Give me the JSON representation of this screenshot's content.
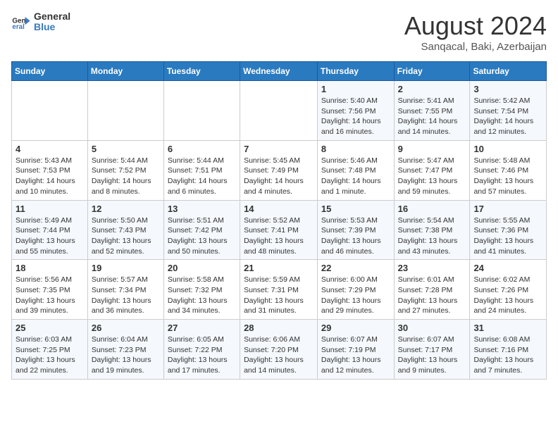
{
  "header": {
    "logo_general": "General",
    "logo_blue": "Blue",
    "month_year": "August 2024",
    "location": "Sanqacal, Baki, Azerbaijan"
  },
  "weekdays": [
    "Sunday",
    "Monday",
    "Tuesday",
    "Wednesday",
    "Thursday",
    "Friday",
    "Saturday"
  ],
  "weeks": [
    [
      {
        "day": "",
        "content": ""
      },
      {
        "day": "",
        "content": ""
      },
      {
        "day": "",
        "content": ""
      },
      {
        "day": "",
        "content": ""
      },
      {
        "day": "1",
        "content": "Sunrise: 5:40 AM\nSunset: 7:56 PM\nDaylight: 14 hours\nand 16 minutes."
      },
      {
        "day": "2",
        "content": "Sunrise: 5:41 AM\nSunset: 7:55 PM\nDaylight: 14 hours\nand 14 minutes."
      },
      {
        "day": "3",
        "content": "Sunrise: 5:42 AM\nSunset: 7:54 PM\nDaylight: 14 hours\nand 12 minutes."
      }
    ],
    [
      {
        "day": "4",
        "content": "Sunrise: 5:43 AM\nSunset: 7:53 PM\nDaylight: 14 hours\nand 10 minutes."
      },
      {
        "day": "5",
        "content": "Sunrise: 5:44 AM\nSunset: 7:52 PM\nDaylight: 14 hours\nand 8 minutes."
      },
      {
        "day": "6",
        "content": "Sunrise: 5:44 AM\nSunset: 7:51 PM\nDaylight: 14 hours\nand 6 minutes."
      },
      {
        "day": "7",
        "content": "Sunrise: 5:45 AM\nSunset: 7:49 PM\nDaylight: 14 hours\nand 4 minutes."
      },
      {
        "day": "8",
        "content": "Sunrise: 5:46 AM\nSunset: 7:48 PM\nDaylight: 14 hours\nand 1 minute."
      },
      {
        "day": "9",
        "content": "Sunrise: 5:47 AM\nSunset: 7:47 PM\nDaylight: 13 hours\nand 59 minutes."
      },
      {
        "day": "10",
        "content": "Sunrise: 5:48 AM\nSunset: 7:46 PM\nDaylight: 13 hours\nand 57 minutes."
      }
    ],
    [
      {
        "day": "11",
        "content": "Sunrise: 5:49 AM\nSunset: 7:44 PM\nDaylight: 13 hours\nand 55 minutes."
      },
      {
        "day": "12",
        "content": "Sunrise: 5:50 AM\nSunset: 7:43 PM\nDaylight: 13 hours\nand 52 minutes."
      },
      {
        "day": "13",
        "content": "Sunrise: 5:51 AM\nSunset: 7:42 PM\nDaylight: 13 hours\nand 50 minutes."
      },
      {
        "day": "14",
        "content": "Sunrise: 5:52 AM\nSunset: 7:41 PM\nDaylight: 13 hours\nand 48 minutes."
      },
      {
        "day": "15",
        "content": "Sunrise: 5:53 AM\nSunset: 7:39 PM\nDaylight: 13 hours\nand 46 minutes."
      },
      {
        "day": "16",
        "content": "Sunrise: 5:54 AM\nSunset: 7:38 PM\nDaylight: 13 hours\nand 43 minutes."
      },
      {
        "day": "17",
        "content": "Sunrise: 5:55 AM\nSunset: 7:36 PM\nDaylight: 13 hours\nand 41 minutes."
      }
    ],
    [
      {
        "day": "18",
        "content": "Sunrise: 5:56 AM\nSunset: 7:35 PM\nDaylight: 13 hours\nand 39 minutes."
      },
      {
        "day": "19",
        "content": "Sunrise: 5:57 AM\nSunset: 7:34 PM\nDaylight: 13 hours\nand 36 minutes."
      },
      {
        "day": "20",
        "content": "Sunrise: 5:58 AM\nSunset: 7:32 PM\nDaylight: 13 hours\nand 34 minutes."
      },
      {
        "day": "21",
        "content": "Sunrise: 5:59 AM\nSunset: 7:31 PM\nDaylight: 13 hours\nand 31 minutes."
      },
      {
        "day": "22",
        "content": "Sunrise: 6:00 AM\nSunset: 7:29 PM\nDaylight: 13 hours\nand 29 minutes."
      },
      {
        "day": "23",
        "content": "Sunrise: 6:01 AM\nSunset: 7:28 PM\nDaylight: 13 hours\nand 27 minutes."
      },
      {
        "day": "24",
        "content": "Sunrise: 6:02 AM\nSunset: 7:26 PM\nDaylight: 13 hours\nand 24 minutes."
      }
    ],
    [
      {
        "day": "25",
        "content": "Sunrise: 6:03 AM\nSunset: 7:25 PM\nDaylight: 13 hours\nand 22 minutes."
      },
      {
        "day": "26",
        "content": "Sunrise: 6:04 AM\nSunset: 7:23 PM\nDaylight: 13 hours\nand 19 minutes."
      },
      {
        "day": "27",
        "content": "Sunrise: 6:05 AM\nSunset: 7:22 PM\nDaylight: 13 hours\nand 17 minutes."
      },
      {
        "day": "28",
        "content": "Sunrise: 6:06 AM\nSunset: 7:20 PM\nDaylight: 13 hours\nand 14 minutes."
      },
      {
        "day": "29",
        "content": "Sunrise: 6:07 AM\nSunset: 7:19 PM\nDaylight: 13 hours\nand 12 minutes."
      },
      {
        "day": "30",
        "content": "Sunrise: 6:07 AM\nSunset: 7:17 PM\nDaylight: 13 hours\nand 9 minutes."
      },
      {
        "day": "31",
        "content": "Sunrise: 6:08 AM\nSunset: 7:16 PM\nDaylight: 13 hours\nand 7 minutes."
      }
    ]
  ]
}
